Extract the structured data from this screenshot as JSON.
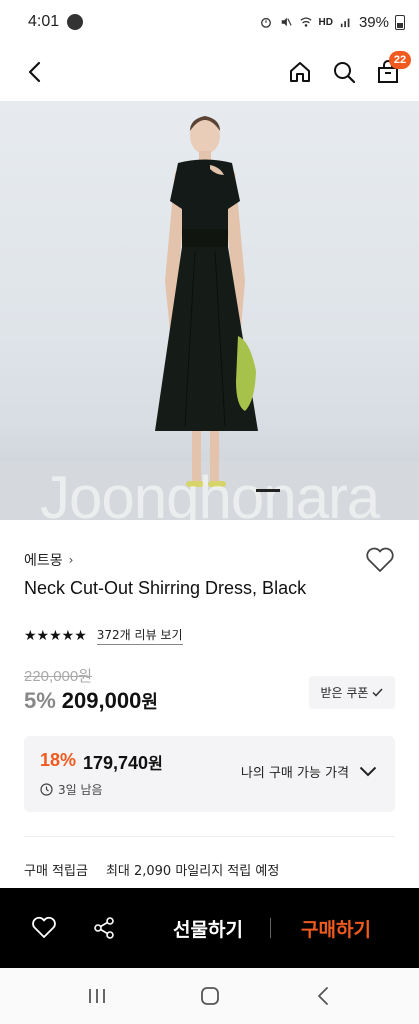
{
  "status_bar": {
    "time": "4:01",
    "network": "HD",
    "battery": "39%"
  },
  "header": {
    "cart_count": "22"
  },
  "product_image": {
    "watermark": "Joonghonara"
  },
  "product": {
    "brand": "에트몽",
    "name": "Neck Cut-Out Shirring Dress, Black",
    "stars": "★★★★★",
    "review_link": "372개 리뷰 보기",
    "original_price": "220,000원",
    "discount_rate": "5%",
    "price": "209,000",
    "price_unit": "원",
    "coupon_label": "받은 쿠폰"
  },
  "best_price": {
    "rate": "18%",
    "amount": "179,740",
    "amount_unit": "원",
    "remaining": "3일 남음",
    "toggle_label": "나의 구매 가능 가격"
  },
  "points": {
    "label": "구매 적립금",
    "value": "최대 2,090 마일리지 적립 예정"
  },
  "action_bar": {
    "gift_label": "선물하기",
    "buy_label": "구매하기"
  },
  "colors": {
    "accent": "#f05a1e",
    "bar_bg": "#000000"
  }
}
